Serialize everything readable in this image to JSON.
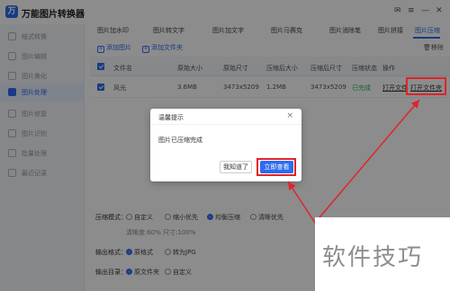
{
  "app": {
    "title": "万能图片转换器",
    "logo_char": "万",
    "window_controls": [
      "✉",
      "≡",
      "—",
      "✕"
    ]
  },
  "sidebar": {
    "items": [
      {
        "label": "格式转换",
        "icon": "convert-icon"
      },
      {
        "label": "图片编辑",
        "icon": "edit-icon"
      },
      {
        "label": "图片美化",
        "icon": "beautify-icon"
      },
      {
        "label": "图片处理",
        "icon": "image-icon"
      },
      {
        "label": "图片修复",
        "icon": "repair-icon"
      },
      {
        "label": "图片识别",
        "icon": "ocr-icon"
      },
      {
        "label": "批量处理",
        "icon": "batch-icon"
      },
      {
        "label": "最近记录",
        "icon": "history-icon"
      }
    ],
    "active_index": 3
  },
  "tabs": [
    "图片加水印",
    "图片转文字",
    "图片加文字",
    "图片马赛克",
    "图片消除笔",
    "图片拼接",
    "图片压缩"
  ],
  "active_tab": "图片压缩",
  "toolbar": {
    "add_image": "添加图片",
    "add_folder": "添加文件夹",
    "clear": "移除"
  },
  "table": {
    "headers": [
      "文件名",
      "原始大小",
      "原始尺寸",
      "压缩后大小",
      "压缩后尺寸",
      "压缩状态",
      "操作"
    ],
    "rows": [
      {
        "name": "风光",
        "orig_size": "3.6MB",
        "orig_dim": "3473x5209",
        "new_size": "1.2MB",
        "new_dim": "3473x5209",
        "status": "已完成",
        "action1": "打开文件",
        "action2": "打开文件夹"
      }
    ]
  },
  "settings": {
    "mode_label": "压缩模式：",
    "mode_options": [
      "自定义",
      "缩小优先",
      "均衡压缩",
      "清晰优先"
    ],
    "mode_selected": "均衡压缩",
    "detail": "清晰度:60%    尺寸:100%",
    "format_label": "输出格式：",
    "format_options": [
      "原格式",
      "转为JPG"
    ],
    "format_selected": "原格式",
    "dir_label": "输出目录：",
    "dir_options": [
      "原文件夹",
      "自定义"
    ],
    "dir_selected": "原文件夹"
  },
  "dialog": {
    "title": "温馨提示",
    "close": "×",
    "message": "图片已压缩完成",
    "btn_secondary": "我知道了",
    "btn_primary": "立即查看"
  },
  "watermark": "软件技巧",
  "colors": {
    "accent": "#2f6bf0",
    "highlight": "#e0242a",
    "success": "#2bb34b"
  }
}
